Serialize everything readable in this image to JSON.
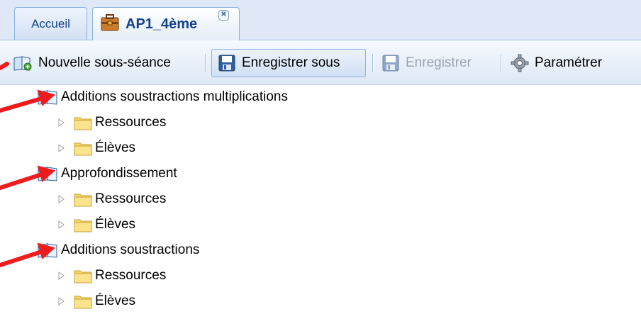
{
  "tabs": {
    "home_label": "Accueil",
    "active_label": "AP1_4ème",
    "close_glyph": "✖"
  },
  "toolbar": {
    "new_subsession": "Nouvelle sous-séance",
    "save_as": "Enregistrer sous",
    "save": "Enregistrer",
    "configure": "Paramétrer"
  },
  "tree": {
    "sessions": [
      {
        "label": "Additions soustractions multiplications",
        "children": [
          "Ressources",
          "Élèves"
        ]
      },
      {
        "label": "Approfondissement",
        "children": [
          "Ressources",
          "Élèves"
        ]
      },
      {
        "label": "Additions soustractions",
        "children": [
          "Ressources",
          "Élèves"
        ]
      }
    ]
  },
  "colors": {
    "accent_blue": "#15428b",
    "annotation_red": "#ee1c1c",
    "folder_yellow": "#f5d56a"
  },
  "icons": {
    "tab_icon": "briefcase-icon",
    "new_subsession": "open-book-add-icon",
    "save_as": "floppy-disk-icon",
    "save": "floppy-disk-icon",
    "configure": "gear-icon",
    "session": "open-book-icon",
    "child": "folder-icon",
    "expander": "triangle-right-icon"
  }
}
